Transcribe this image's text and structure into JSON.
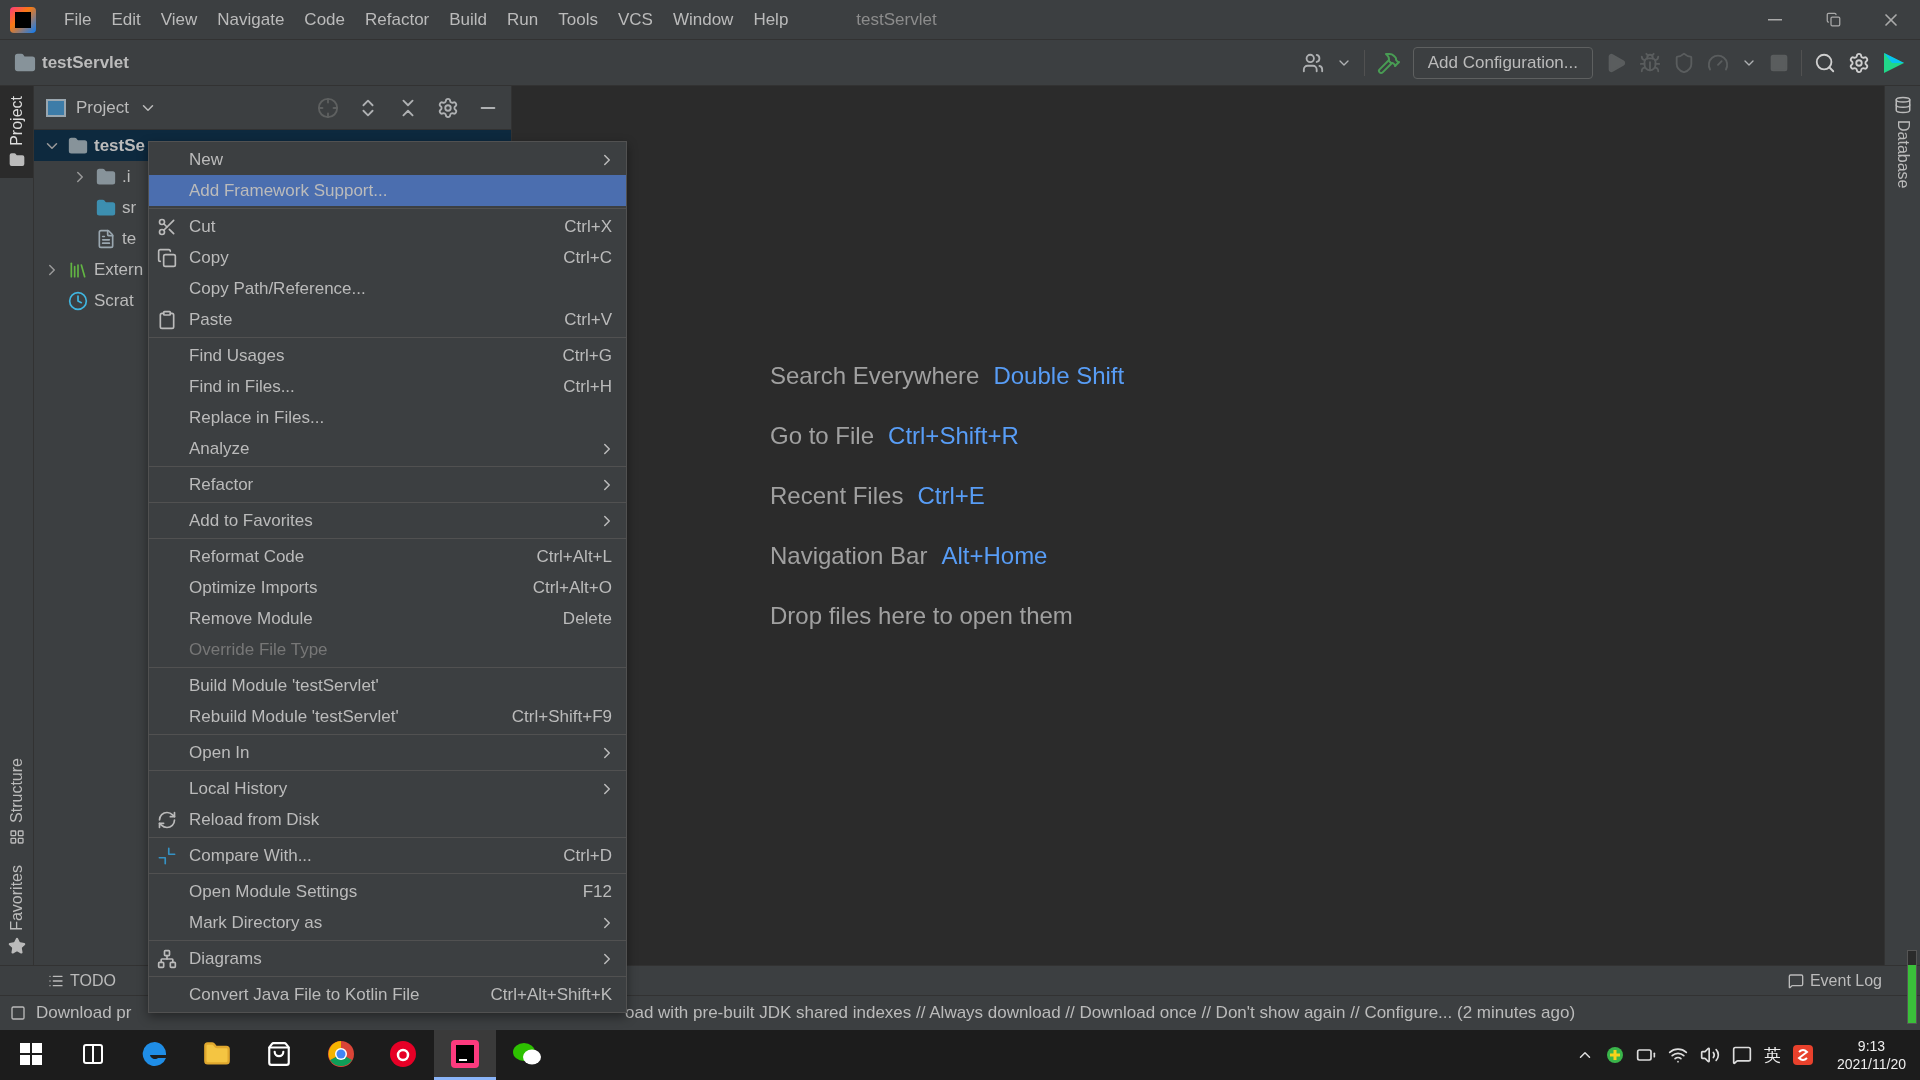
{
  "menu_bar": {
    "items": [
      {
        "label": "File"
      },
      {
        "label": "Edit"
      },
      {
        "label": "View"
      },
      {
        "label": "Navigate"
      },
      {
        "label": "Code"
      },
      {
        "label": "Refactor"
      },
      {
        "label": "Build"
      },
      {
        "label": "Run"
      },
      {
        "label": "Tools"
      },
      {
        "label": "VCS"
      },
      {
        "label": "Window"
      },
      {
        "label": "Help"
      }
    ],
    "title": "testServlet"
  },
  "nav_bar": {
    "project": "testServlet",
    "run_config": "Add Configuration..."
  },
  "left_stripe": [
    {
      "label": "Project",
      "selected": true
    },
    {
      "label": "Structure",
      "selected": false
    },
    {
      "label": "Favorites",
      "selected": false
    }
  ],
  "right_stripe": [
    {
      "label": "Database",
      "selected": false
    }
  ],
  "project_panel": {
    "title": "Project",
    "tree": [
      {
        "label": "testSe",
        "kind": "module",
        "expanded": true,
        "selected": true,
        "children": [
          {
            "label": ".i",
            "kind": "folder",
            "expanded": false,
            "selected": false
          },
          {
            "label": "sr",
            "kind": "source",
            "selected": false
          },
          {
            "label": "te",
            "kind": "file",
            "selected": false
          }
        ]
      },
      {
        "label": "Extern",
        "kind": "library",
        "expanded": false,
        "selected": false
      },
      {
        "label": "Scrat",
        "kind": "scratch",
        "selected": false
      }
    ]
  },
  "context_menu": [
    {
      "kind": "item",
      "label": "New",
      "submenu": true,
      "selected": false,
      "disabled": false
    },
    {
      "kind": "item",
      "label": "Add Framework Support...",
      "submenu": false,
      "selected": true,
      "disabled": false
    },
    {
      "kind": "separator"
    },
    {
      "kind": "item",
      "label": "Cut",
      "shortcut": "Ctrl+X",
      "submenu": false,
      "selected": false,
      "disabled": false
    },
    {
      "kind": "item",
      "label": "Copy",
      "shortcut": "Ctrl+C",
      "submenu": false,
      "selected": false,
      "disabled": false
    },
    {
      "kind": "item",
      "label": "Copy Path/Reference...",
      "submenu": false,
      "selected": false,
      "disabled": false
    },
    {
      "kind": "item",
      "label": "Paste",
      "shortcut": "Ctrl+V",
      "submenu": false,
      "selected": false,
      "disabled": false
    },
    {
      "kind": "separator"
    },
    {
      "kind": "item",
      "label": "Find Usages",
      "shortcut": "Ctrl+G",
      "submenu": false,
      "selected": false,
      "disabled": false
    },
    {
      "kind": "item",
      "label": "Find in Files...",
      "shortcut": "Ctrl+H",
      "submenu": false,
      "selected": false,
      "disabled": false
    },
    {
      "kind": "item",
      "label": "Replace in Files...",
      "submenu": false,
      "selected": false,
      "disabled": false
    },
    {
      "kind": "item",
      "label": "Analyze",
      "submenu": true,
      "selected": false,
      "disabled": false
    },
    {
      "kind": "separator"
    },
    {
      "kind": "item",
      "label": "Refactor",
      "submenu": true,
      "selected": false,
      "disabled": false
    },
    {
      "kind": "separator"
    },
    {
      "kind": "item",
      "label": "Add to Favorites",
      "submenu": true,
      "selected": false,
      "disabled": false
    },
    {
      "kind": "separator"
    },
    {
      "kind": "item",
      "label": "Reformat Code",
      "shortcut": "Ctrl+Alt+L",
      "submenu": false,
      "selected": false,
      "disabled": false
    },
    {
      "kind": "item",
      "label": "Optimize Imports",
      "shortcut": "Ctrl+Alt+O",
      "submenu": false,
      "selected": false,
      "disabled": false
    },
    {
      "kind": "item",
      "label": "Remove Module",
      "shortcut": "Delete",
      "submenu": false,
      "selected": false,
      "disabled": false
    },
    {
      "kind": "item",
      "label": "Override File Type",
      "submenu": false,
      "selected": false,
      "disabled": true
    },
    {
      "kind": "separator"
    },
    {
      "kind": "item",
      "label": "Build Module 'testServlet'",
      "submenu": false,
      "selected": false,
      "disabled": false
    },
    {
      "kind": "item",
      "label": "Rebuild Module 'testServlet'",
      "shortcut": "Ctrl+Shift+F9",
      "submenu": false,
      "selected": false,
      "disabled": false
    },
    {
      "kind": "separator"
    },
    {
      "kind": "item",
      "label": "Open In",
      "submenu": true,
      "selected": false,
      "disabled": false
    },
    {
      "kind": "separator"
    },
    {
      "kind": "item",
      "label": "Local History",
      "submenu": true,
      "selected": false,
      "disabled": false
    },
    {
      "kind": "item",
      "label": "Reload from Disk",
      "submenu": false,
      "selected": false,
      "disabled": false
    },
    {
      "kind": "separator"
    },
    {
      "kind": "item",
      "label": "Compare With...",
      "shortcut": "Ctrl+D",
      "submenu": false,
      "selected": false,
      "disabled": false
    },
    {
      "kind": "separator"
    },
    {
      "kind": "item",
      "label": "Open Module Settings",
      "shortcut": "F12",
      "submenu": false,
      "selected": false,
      "disabled": false
    },
    {
      "kind": "item",
      "label": "Mark Directory as",
      "submenu": true,
      "selected": false,
      "disabled": false
    },
    {
      "kind": "separator"
    },
    {
      "kind": "item",
      "label": "Diagrams",
      "submenu": true,
      "selected": false,
      "disabled": false
    },
    {
      "kind": "separator"
    },
    {
      "kind": "item",
      "label": "Convert Java File to Kotlin File",
      "shortcut": "Ctrl+Alt+Shift+K",
      "submenu": false,
      "selected": false,
      "disabled": false
    }
  ],
  "editor": {
    "hints": [
      {
        "label": "Search Everywhere",
        "shortcut": "Double Shift"
      },
      {
        "label": "Go to File",
        "shortcut": "Ctrl+Shift+R"
      },
      {
        "label": "Recent Files",
        "shortcut": "Ctrl+E"
      },
      {
        "label": "Navigation Bar",
        "shortcut": "Alt+Home"
      },
      {
        "label": "Drop files here to open them"
      }
    ]
  },
  "bottom_bar": {
    "tabs": [
      {
        "label": "TODO"
      }
    ],
    "event_log": "Event Log"
  },
  "status_bar": {
    "left": "Download pr",
    "right": "oad with pre-built JDK shared indexes // Always download // Download once // Don't show again // Configure... (2 minutes ago)"
  },
  "taskbar": {
    "apps": [
      {
        "selected": false
      },
      {
        "selected": false
      },
      {
        "selected": false
      },
      {
        "selected": false
      },
      {
        "selected": false
      },
      {
        "selected": false
      },
      {
        "selected": true
      },
      {
        "selected": false
      }
    ],
    "ime": "英",
    "time": "9:13",
    "date": "2021/11/20"
  }
}
